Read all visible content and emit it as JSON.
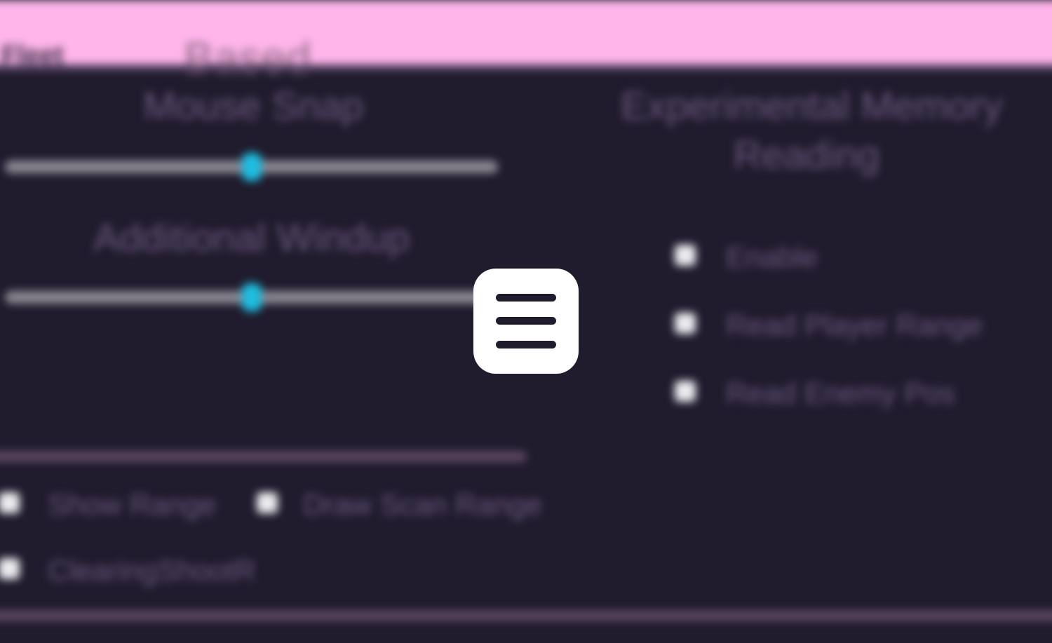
{
  "header": {
    "tabs": [
      {
        "label": "Fleet"
      },
      {
        "label": "Based"
      }
    ]
  },
  "left_panel": {
    "sliders": [
      {
        "label": "Mouse Snap",
        "value_fraction": 0.5
      },
      {
        "label": "Additional Windup",
        "value_fraction": 0.5
      }
    ],
    "checkboxes": [
      {
        "label": "Show Range"
      },
      {
        "label": "Draw Scan Range"
      },
      {
        "label": "ClearingShootR"
      }
    ]
  },
  "right_panel": {
    "title_line1": "Experimental Memory",
    "title_line2": "Reading",
    "checkboxes": [
      {
        "label": "Enable"
      },
      {
        "label": "Read Player Range"
      },
      {
        "label": "Read Enemy Pos"
      }
    ]
  },
  "overlay": {
    "menu_icon": "menu-icon"
  },
  "colors": {
    "header_bg": "#ffb5ea",
    "panel_bg": "#201b2d",
    "accent": "#1ebde0",
    "divider": "#5a4560",
    "text_muted": "#6b5a7e"
  }
}
